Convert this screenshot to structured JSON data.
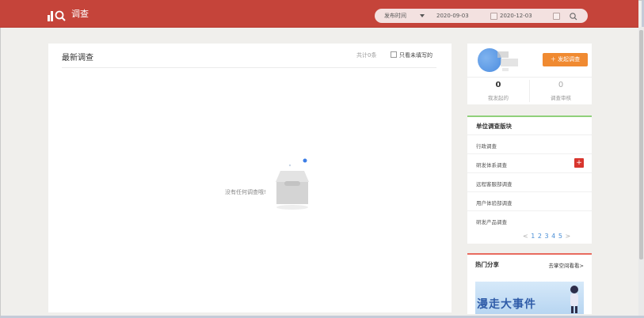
{
  "app": {
    "title": "调查"
  },
  "filter": {
    "field": "发布时间",
    "date_start": "2020-09-03",
    "date_end": "2020-12-03"
  },
  "main": {
    "title": "最新调查",
    "count": "共计0条",
    "only_unfilled": "只看未填写的",
    "empty_text": "没有任何调查哦!"
  },
  "profile": {
    "launch_button": "发起调查",
    "stats": [
      {
        "value": "0",
        "label": "我发起的"
      },
      {
        "value": "0",
        "label": "调查审核"
      }
    ]
  },
  "unit_section": {
    "title": "单位调查版块",
    "items": [
      "行政调查",
      "研发体系调查",
      "远程客服部调查",
      "用户体验部调查",
      "研发产品调查"
    ],
    "pager": {
      "prev": "<",
      "pages": [
        "1",
        "2",
        "3",
        "4",
        "5"
      ],
      "next": ">"
    }
  },
  "hot": {
    "title": "热门分享",
    "link": "去掌空间看看>",
    "banner_text": "漫走大事件"
  },
  "colors": {
    "topbar": "#c5443a",
    "accent_orange": "#f08a31",
    "pager_blue": "#4a8fd6"
  }
}
